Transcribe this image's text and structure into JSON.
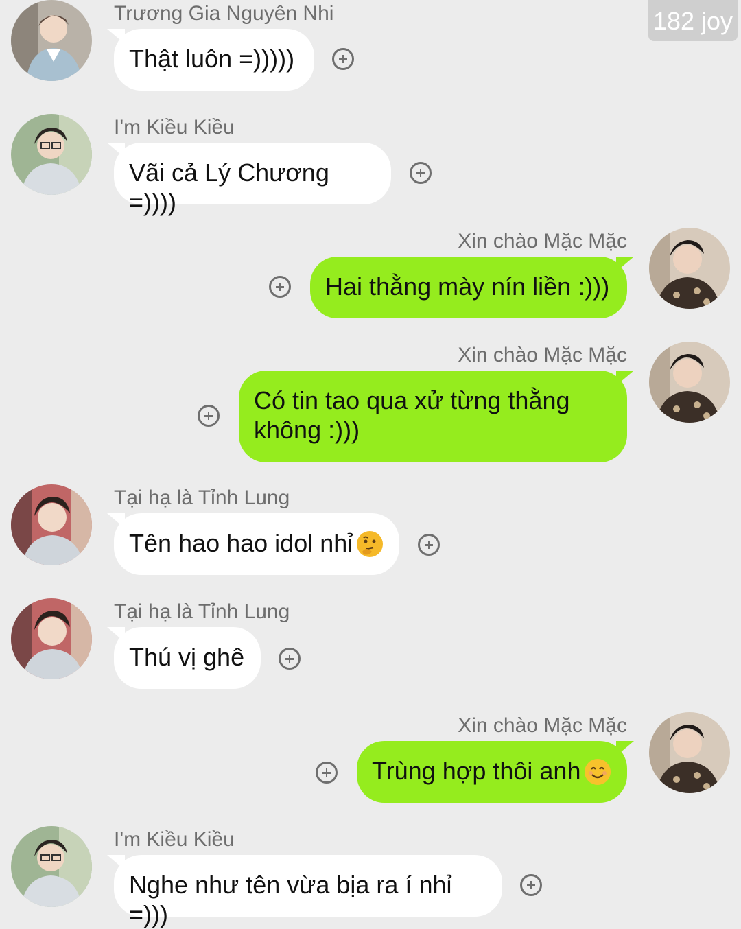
{
  "watermark": "182 joy",
  "messages": [
    {
      "side": "left",
      "sender": "Trương Gia Nguyên Nhi",
      "text": "Thật luôn =)))))",
      "avatar": "avatar-truong-gia-nguyen-nhi"
    },
    {
      "side": "left",
      "sender": "I'm Kiều Kiều",
      "text": "Vãi cả Lý Chương =))))",
      "avatar": "avatar-kieu-kieu"
    },
    {
      "side": "right",
      "sender": "Xin chào Mặc Mặc",
      "text": "Hai thằng mày nín liền :)))",
      "avatar": "avatar-mac-mac"
    },
    {
      "side": "right",
      "sender": "Xin chào Mặc Mặc",
      "text": "Có tin tao qua xử từng thằng không :)))",
      "avatar": "avatar-mac-mac"
    },
    {
      "side": "left",
      "sender": "Tại hạ là Tỉnh Lung",
      "text": "Tên hao hao idol nhỉ",
      "emoji": "thinking-face-emoji",
      "avatar": "avatar-tinh-lung"
    },
    {
      "side": "left",
      "sender": "Tại hạ là Tỉnh Lung",
      "text": "Thú vị ghê",
      "avatar": "avatar-tinh-lung"
    },
    {
      "side": "right",
      "sender": "Xin chào Mặc Mặc",
      "text": "Trùng hợp thôi anh",
      "emoji": "smiling-face-emoji",
      "avatar": "avatar-mac-mac"
    },
    {
      "side": "left",
      "sender": "I'm Kiều Kiều",
      "text": "Nghe như tên vừa bịa ra í nhỉ =)))",
      "avatar": "avatar-kieu-kieu"
    }
  ],
  "colors": {
    "background": "#ececec",
    "bubble_self": "#95ec1e",
    "bubble_other": "#ffffff",
    "sender_text": "#6d6d6d",
    "icon": "#6f6f6f"
  },
  "icons": {
    "add": "plus-circle-icon"
  }
}
